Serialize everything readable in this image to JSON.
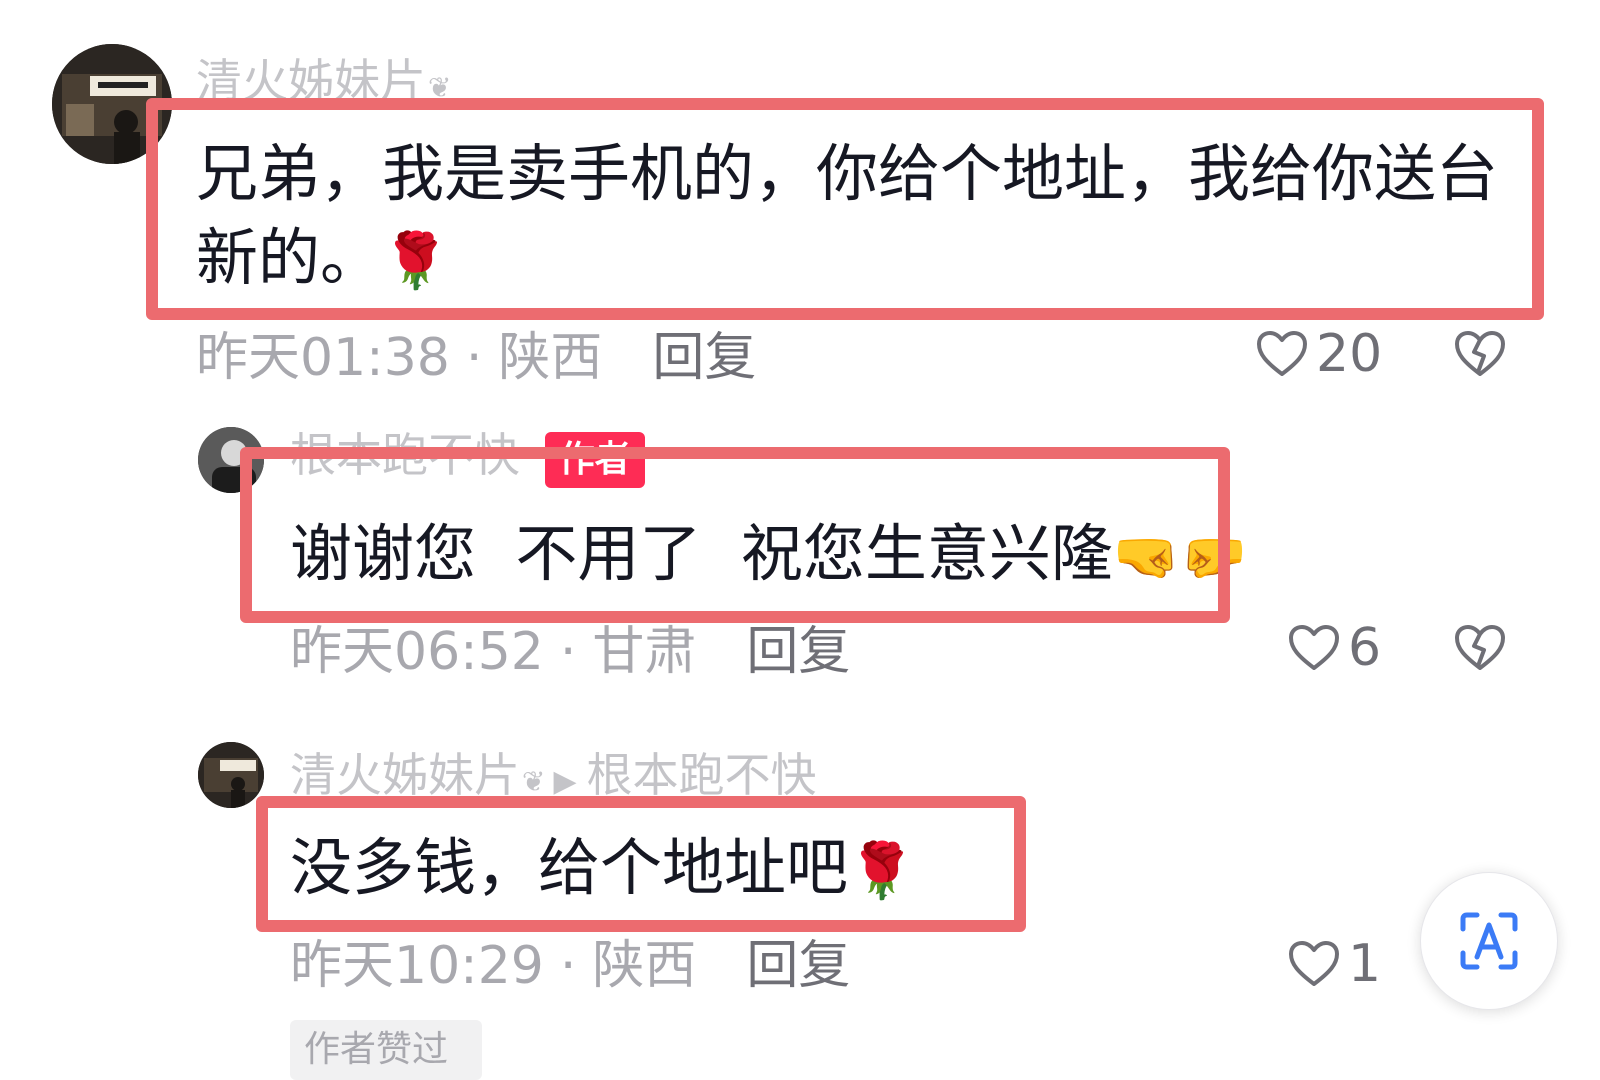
{
  "comments": [
    {
      "username": "清火姊妹片",
      "user_badge_icon": "leaf-icon",
      "text_line1": "兄弟，我是卖手机的，你给个地址，我给你送台",
      "text_line2": "新的。",
      "emoji": "🌹",
      "time": "昨天01:38",
      "location": "陕西",
      "reply_label": "回复",
      "likes": "20"
    },
    {
      "username": "根本跑不快",
      "author_tag": "作者",
      "text": "谢谢您  不用了  祝您生意兴隆",
      "emoji": "🤜🤛",
      "time": "昨天06:52",
      "location": "甘肃",
      "reply_label": "回复",
      "likes": "6"
    },
    {
      "username": "清火姊妹片",
      "user_badge_icon": "leaf-icon",
      "reply_to": "根本跑不快",
      "text": "没多钱，给个地址吧",
      "emoji": "🌹",
      "time": "昨天10:29",
      "location": "陕西",
      "reply_label": "回复",
      "likes": "1"
    }
  ],
  "footer_chip": "作者赞过",
  "floating_button_icon": "text-recognition-icon",
  "colors": {
    "highlight_border": "#ec6b6f",
    "author_tag": "#fe2c55",
    "meta_gray": "#a8a8ae",
    "name_gray": "#c4c4c8"
  }
}
